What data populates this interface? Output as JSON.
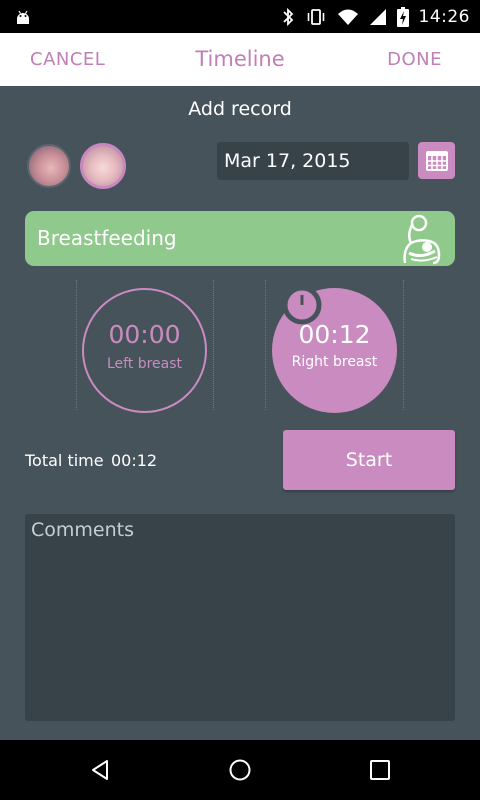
{
  "status_bar": {
    "time": "14:26",
    "icons": [
      "android-icon",
      "bluetooth-icon",
      "vibrate-icon",
      "wifi-icon",
      "signal-icon",
      "battery-charging-icon"
    ]
  },
  "app_bar": {
    "cancel_label": "CANCEL",
    "title": "Timeline",
    "done_label": "DONE"
  },
  "form": {
    "heading": "Add record",
    "date": "Mar 17, 2015",
    "record_type": "Breastfeeding",
    "left_timer": {
      "value": "00:00",
      "label": "Left breast"
    },
    "right_timer": {
      "value": "00:12",
      "label": "Right breast"
    },
    "total_label": "Total time",
    "total_value": "00:12",
    "start_label": "Start",
    "comments_placeholder": "Comments"
  },
  "colors": {
    "accent": "#c98bc0",
    "type_bar": "#8fc98b",
    "background": "#46535b",
    "field": "#384249"
  },
  "nav": {
    "buttons": [
      "back-icon",
      "home-icon",
      "recents-icon"
    ]
  }
}
